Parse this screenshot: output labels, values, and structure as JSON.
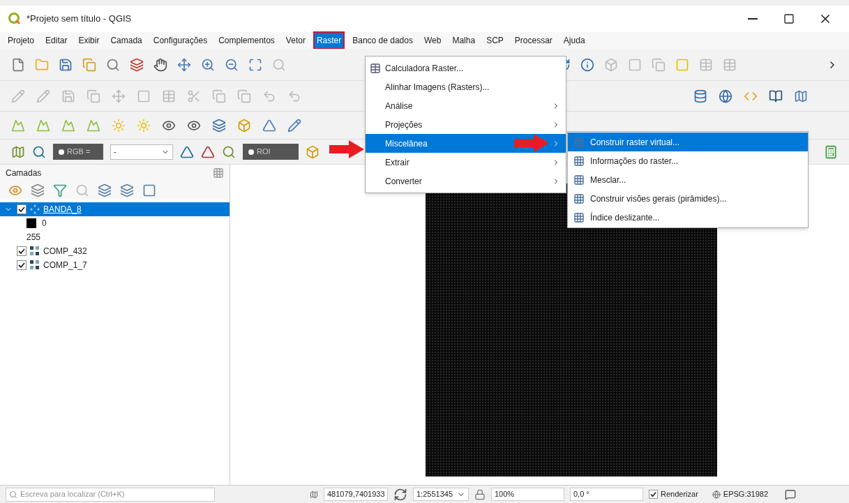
{
  "window": {
    "title": "*Projeto sem título - QGIS"
  },
  "menu_bar": [
    {
      "label": "Projeto",
      "selected": false
    },
    {
      "label": "Editar",
      "selected": false
    },
    {
      "label": "Exibir",
      "selected": false
    },
    {
      "label": "Camada",
      "selected": false
    },
    {
      "label": "Configurações",
      "selected": false
    },
    {
      "label": "Complementos",
      "selected": false
    },
    {
      "label": "Vetor",
      "selected": false
    },
    {
      "label": "Raster",
      "selected": true,
      "outlined": true
    },
    {
      "label": "Banco de dados",
      "selected": false
    },
    {
      "label": "Web",
      "selected": false
    },
    {
      "label": "Malha",
      "selected": false
    },
    {
      "label": "SCP",
      "selected": false
    },
    {
      "label": "Processar",
      "selected": false
    },
    {
      "label": "Ajuda",
      "selected": false
    }
  ],
  "raster_menu": [
    {
      "label": "Calculadora Raster...",
      "submenu": false,
      "selected": false,
      "icon": true
    },
    {
      "label": "Alinhar Imagens (Rasters)...",
      "submenu": false,
      "selected": false,
      "icon": false
    },
    {
      "label": "Análise",
      "submenu": true,
      "selected": false,
      "icon": false
    },
    {
      "label": "Projeções",
      "submenu": true,
      "selected": false,
      "icon": false
    },
    {
      "label": "Miscelânea",
      "submenu": true,
      "selected": true,
      "icon": false
    },
    {
      "label": "Extrair",
      "submenu": true,
      "selected": false,
      "icon": false
    },
    {
      "label": "Converter",
      "submenu": true,
      "selected": false,
      "icon": false
    }
  ],
  "misc_submenu": [
    {
      "label": "Construir raster virtual...",
      "selected": true
    },
    {
      "label": "Informações do raster...",
      "selected": false
    },
    {
      "label": "Mesclar...",
      "selected": false
    },
    {
      "label": "Construir visões gerais (pirâmides)...",
      "selected": false
    },
    {
      "label": "Índice deslizante...",
      "selected": false
    }
  ],
  "scp_toolbar": {
    "rgb_label": "RGB =",
    "band_value": "-",
    "roi_label": "ROI"
  },
  "layers_panel": {
    "title": "Camadas",
    "layers": [
      {
        "name": "BANDA_8",
        "checked": true,
        "selected": true,
        "expanded": true,
        "kind": "singleband",
        "children": [
          {
            "label": "0",
            "color": "#000000"
          },
          {
            "label": "255"
          }
        ]
      },
      {
        "name": "COMP_432",
        "checked": true,
        "selected": false,
        "expanded": false,
        "kind": "multiband"
      },
      {
        "name": "COMP_1_7",
        "checked": true,
        "selected": false,
        "expanded": false,
        "kind": "multiband"
      }
    ]
  },
  "status_bar": {
    "search_placeholder": "Escreva para localizar (Ctrl+K)",
    "coordinate": "481079,7401933",
    "scale": "1:2551345",
    "magnifier": "100%",
    "rotation": "0,0 °",
    "render": {
      "label": "Renderizar",
      "checked": true
    },
    "crs": "EPSG:31982"
  }
}
